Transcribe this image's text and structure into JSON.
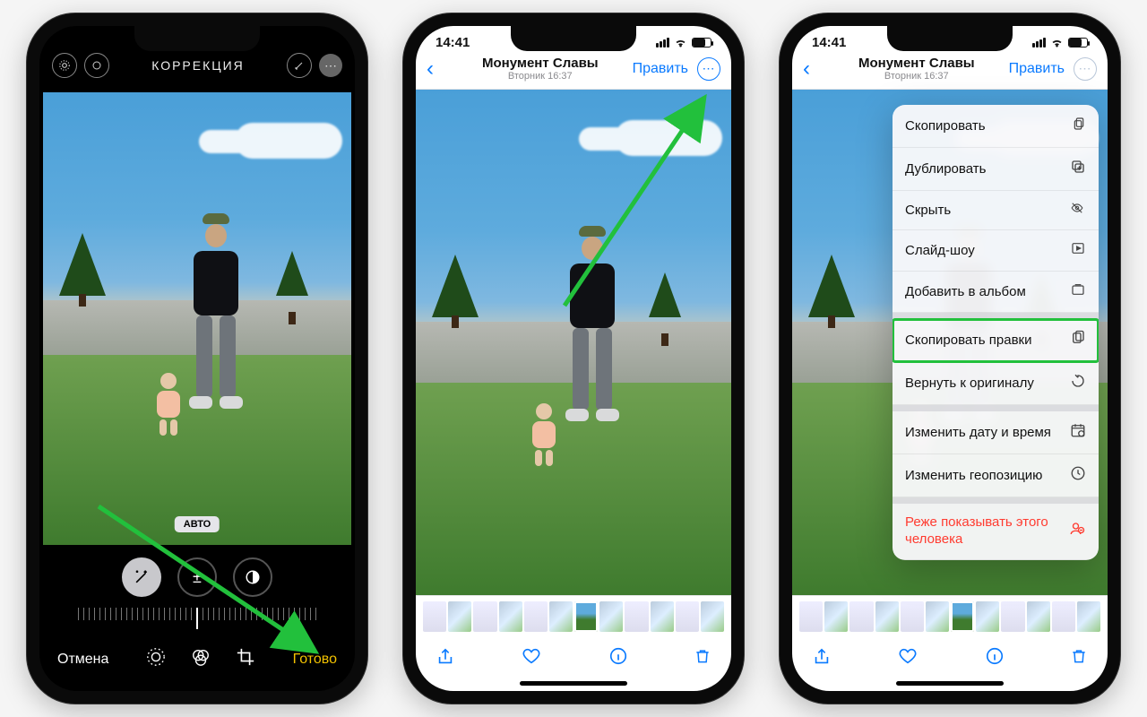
{
  "phone1": {
    "title": "КОРРЕКЦИЯ",
    "auto_badge": "АВТО",
    "cancel": "Отмена",
    "done": "Готово"
  },
  "phone2": {
    "status_time": "14:41",
    "nav_title": "Монумент Славы",
    "nav_sub": "Вторник  16:37",
    "edit": "Править"
  },
  "phone3": {
    "status_time": "14:41",
    "nav_title": "Монумент Славы",
    "nav_sub": "Вторник  16:37",
    "edit": "Править",
    "menu": {
      "copy": "Скопировать",
      "duplicate": "Дублировать",
      "hide": "Скрыть",
      "slideshow": "Слайд-шоу",
      "add_album": "Добавить в альбом",
      "copy_edits": "Скопировать правки",
      "revert": "Вернуть к оригиналу",
      "adjust_datetime": "Изменить дату и время",
      "adjust_location": "Изменить геопозицию",
      "feature_less": "Реже показывать этого человека"
    }
  }
}
